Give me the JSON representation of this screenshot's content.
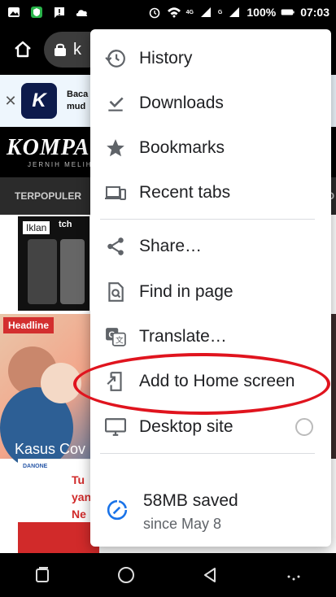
{
  "statusbar": {
    "battery": "100%",
    "time": "07:03",
    "net1": "4G",
    "net2": "G"
  },
  "toolbar": {
    "url_partial": "k"
  },
  "page": {
    "ad_text_line1": "Baca",
    "ad_text_line2": "mud",
    "site_logo": "KOMPA",
    "site_tagline": "JERNIH MELIHA",
    "nav_item": "TERPOPULER",
    "nav_right": "D",
    "iklan_label": "Iklan",
    "phone_text": "tch",
    "headline_badge": "Headline",
    "headline_caption": "Kasus Cov",
    "ad2_brand": "DANONE",
    "ad2_line1": "Tu",
    "ad2_line2": "yan",
    "ad2_line3": "Ne"
  },
  "menu": {
    "items": [
      {
        "label": "History",
        "icon": "history-icon"
      },
      {
        "label": "Downloads",
        "icon": "download-icon"
      },
      {
        "label": "Bookmarks",
        "icon": "star-icon"
      },
      {
        "label": "Recent tabs",
        "icon": "devices-icon"
      },
      {
        "label": "Share…",
        "icon": "share-icon"
      },
      {
        "label": "Find in page",
        "icon": "find-in-page-icon"
      },
      {
        "label": "Translate…",
        "icon": "translate-icon"
      },
      {
        "label": "Add to Home screen",
        "icon": "add-to-home-icon"
      },
      {
        "label": "Desktop site",
        "icon": "desktop-icon"
      }
    ],
    "saved_title": "58MB saved",
    "saved_sub": "since May 8"
  },
  "colors": {
    "annotation_red": "#e0141e",
    "accent_blue": "#1a73e8",
    "icon_gray": "#5f6368"
  }
}
